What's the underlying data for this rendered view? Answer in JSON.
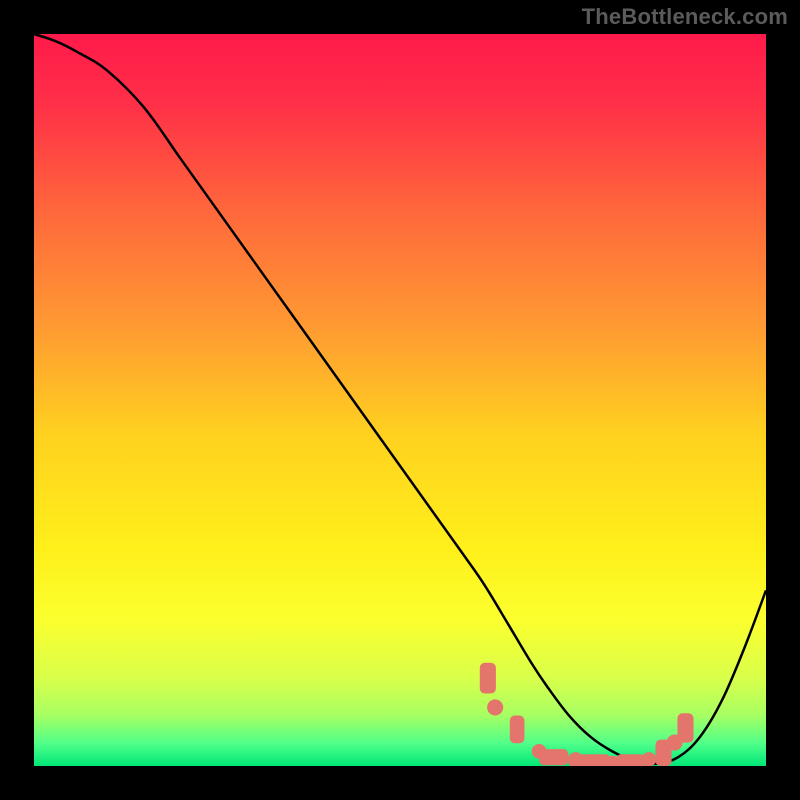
{
  "watermark": "TheBottleneck.com",
  "colors": {
    "frame": "#000000",
    "marker": "#e4756c",
    "curve": "#000000",
    "gradient_stops": [
      {
        "offset": 0.0,
        "color": "#ff1a4b"
      },
      {
        "offset": 0.1,
        "color": "#ff3147"
      },
      {
        "offset": 0.25,
        "color": "#ff6a3b"
      },
      {
        "offset": 0.4,
        "color": "#ff9a32"
      },
      {
        "offset": 0.55,
        "color": "#ffd21f"
      },
      {
        "offset": 0.7,
        "color": "#ffef1b"
      },
      {
        "offset": 0.8,
        "color": "#fbff2e"
      },
      {
        "offset": 0.88,
        "color": "#d9ff4a"
      },
      {
        "offset": 0.93,
        "color": "#a8ff62"
      },
      {
        "offset": 0.97,
        "color": "#4eff8a"
      },
      {
        "offset": 1.0,
        "color": "#00e676"
      }
    ]
  },
  "chart_data": {
    "type": "line",
    "title": "",
    "xlabel": "",
    "ylabel": "",
    "xlim": [
      0,
      100
    ],
    "ylim": [
      0,
      100
    ],
    "grid": false,
    "legend": false,
    "series": [
      {
        "name": "bottleneck-curve",
        "x": [
          0,
          3,
          6,
          10,
          15,
          20,
          25,
          30,
          35,
          40,
          45,
          50,
          55,
          60,
          62,
          65,
          68,
          70,
          73,
          76,
          79,
          82,
          85,
          88,
          91,
          94,
          97,
          100
        ],
        "y": [
          100,
          99,
          97.5,
          95,
          90,
          83,
          76,
          69,
          62,
          55,
          48,
          41,
          34,
          27,
          24,
          19,
          14,
          11,
          7,
          4,
          2,
          0.7,
          0.3,
          1.2,
          4,
          9,
          16,
          24
        ]
      }
    ],
    "markers": {
      "name": "minimum-markers",
      "points": [
        {
          "x": 62,
          "y": 12,
          "shape": "pill",
          "w": 2.2,
          "h": 4.2
        },
        {
          "x": 63,
          "y": 8,
          "shape": "dot",
          "r": 1.1
        },
        {
          "x": 66,
          "y": 5,
          "shape": "pill",
          "w": 2.0,
          "h": 3.8
        },
        {
          "x": 69,
          "y": 2,
          "shape": "dot",
          "r": 1.0
        },
        {
          "x": 71,
          "y": 1.2,
          "shape": "pill",
          "w": 4.0,
          "h": 2.2
        },
        {
          "x": 74,
          "y": 0.8,
          "shape": "dot",
          "r": 1.1
        },
        {
          "x": 76.5,
          "y": 0.5,
          "shape": "pill",
          "w": 4.5,
          "h": 2.2
        },
        {
          "x": 79,
          "y": 0.4,
          "shape": "dot",
          "r": 1.0
        },
        {
          "x": 81.5,
          "y": 0.5,
          "shape": "pill",
          "w": 4.0,
          "h": 2.2
        },
        {
          "x": 84,
          "y": 0.9,
          "shape": "dot",
          "r": 1.0
        },
        {
          "x": 86,
          "y": 1.8,
          "shape": "pill",
          "w": 2.2,
          "h": 3.6
        },
        {
          "x": 87.5,
          "y": 3.2,
          "shape": "dot",
          "r": 1.1
        },
        {
          "x": 89,
          "y": 5.2,
          "shape": "pill",
          "w": 2.2,
          "h": 4.0
        }
      ]
    }
  }
}
